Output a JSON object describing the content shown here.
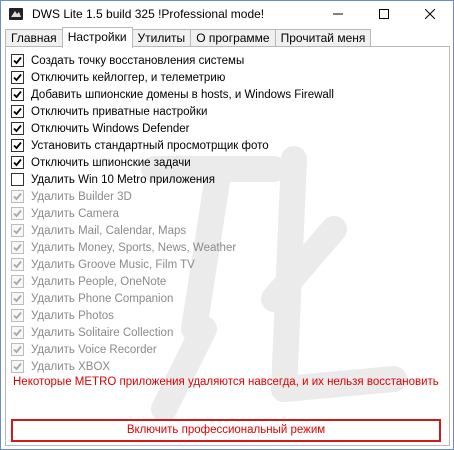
{
  "window": {
    "title": "DWS Lite 1.5 build 325  !Professional mode!"
  },
  "tabs": [
    {
      "label": "Главная"
    },
    {
      "label": "Настройки"
    },
    {
      "label": "Утилиты"
    },
    {
      "label": "О программе"
    },
    {
      "label": "Прочитай меня"
    }
  ],
  "active_tab": "Настройки",
  "options": [
    {
      "label": "Создать точку восстановления системы",
      "checked": true,
      "enabled": true
    },
    {
      "label": "Отключить кейлоггер, и телеметрию",
      "checked": true,
      "enabled": true
    },
    {
      "label": "Добавить шпионские домены в hosts, и Windows Firewall",
      "checked": true,
      "enabled": true
    },
    {
      "label": "Отключить приватные настройки",
      "checked": true,
      "enabled": true
    },
    {
      "label": "Отключить Windows Defender",
      "checked": true,
      "enabled": true
    },
    {
      "label": "Установить стандартный просмотрщик фото",
      "checked": true,
      "enabled": true
    },
    {
      "label": "Отключить шпионские задачи",
      "checked": true,
      "enabled": true
    },
    {
      "label": "Удалить Win 10 Metro приложения",
      "checked": false,
      "enabled": true
    },
    {
      "label": "Удалить Builder 3D",
      "checked": true,
      "enabled": false
    },
    {
      "label": "Удалить Camera",
      "checked": true,
      "enabled": false
    },
    {
      "label": "Удалить Mail, Calendar, Maps",
      "checked": true,
      "enabled": false
    },
    {
      "label": "Удалить Money, Sports, News, Weather",
      "checked": true,
      "enabled": false
    },
    {
      "label": "Удалить Groove Music, Film TV",
      "checked": true,
      "enabled": false
    },
    {
      "label": "Удалить People, OneNote",
      "checked": true,
      "enabled": false
    },
    {
      "label": "Удалить Phone Companion",
      "checked": true,
      "enabled": false
    },
    {
      "label": "Удалить Photos",
      "checked": true,
      "enabled": false
    },
    {
      "label": "Удалить Solitaire Collection",
      "checked": true,
      "enabled": false
    },
    {
      "label": "Удалить Voice Recorder",
      "checked": true,
      "enabled": false
    },
    {
      "label": "Удалить XBOX",
      "checked": true,
      "enabled": false
    }
  ],
  "warning_text": "Некоторые METRO приложения удаляются навсегда, и их нельзя восстановить",
  "pro_button_label": "Включить профессиональный режим",
  "colors": {
    "warning": "#e00000",
    "button_border": "#d11a1a",
    "window_border": "#6b8bc9"
  },
  "icons": {
    "app": "dws-app-icon",
    "minimize": "minimize-icon",
    "maximize": "maximize-icon",
    "close": "close-icon",
    "checkbox": "checkmark-icon"
  }
}
